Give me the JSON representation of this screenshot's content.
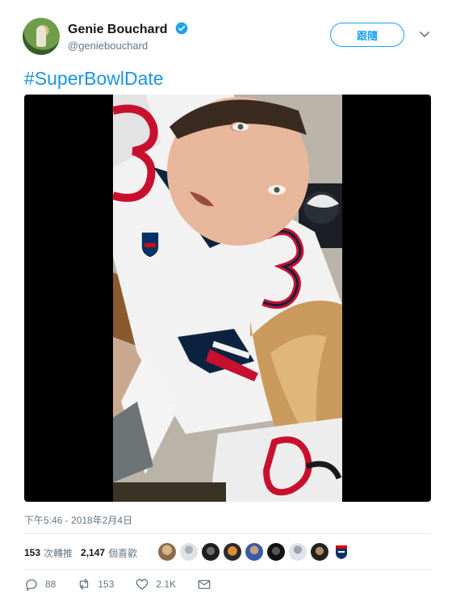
{
  "user": {
    "display_name": "Genie Bouchard",
    "handle": "@geniebouchard",
    "verified": true
  },
  "follow_button": {
    "label": "跟隨"
  },
  "tweet": {
    "text": "#SuperBowlDate",
    "timestamp": "下午5:46 - 2018年2月4日"
  },
  "stats": {
    "retweets_count": "153",
    "retweets_label": "次轉推",
    "likes_count": "2,147",
    "likes_label": "個喜歡"
  },
  "actions": {
    "reply_count": "88",
    "retweet_count": "153",
    "like_count": "2.1K"
  },
  "colors": {
    "accent": "#1da1f2",
    "hashtag": "#1b95e0",
    "muted": "#657786"
  }
}
